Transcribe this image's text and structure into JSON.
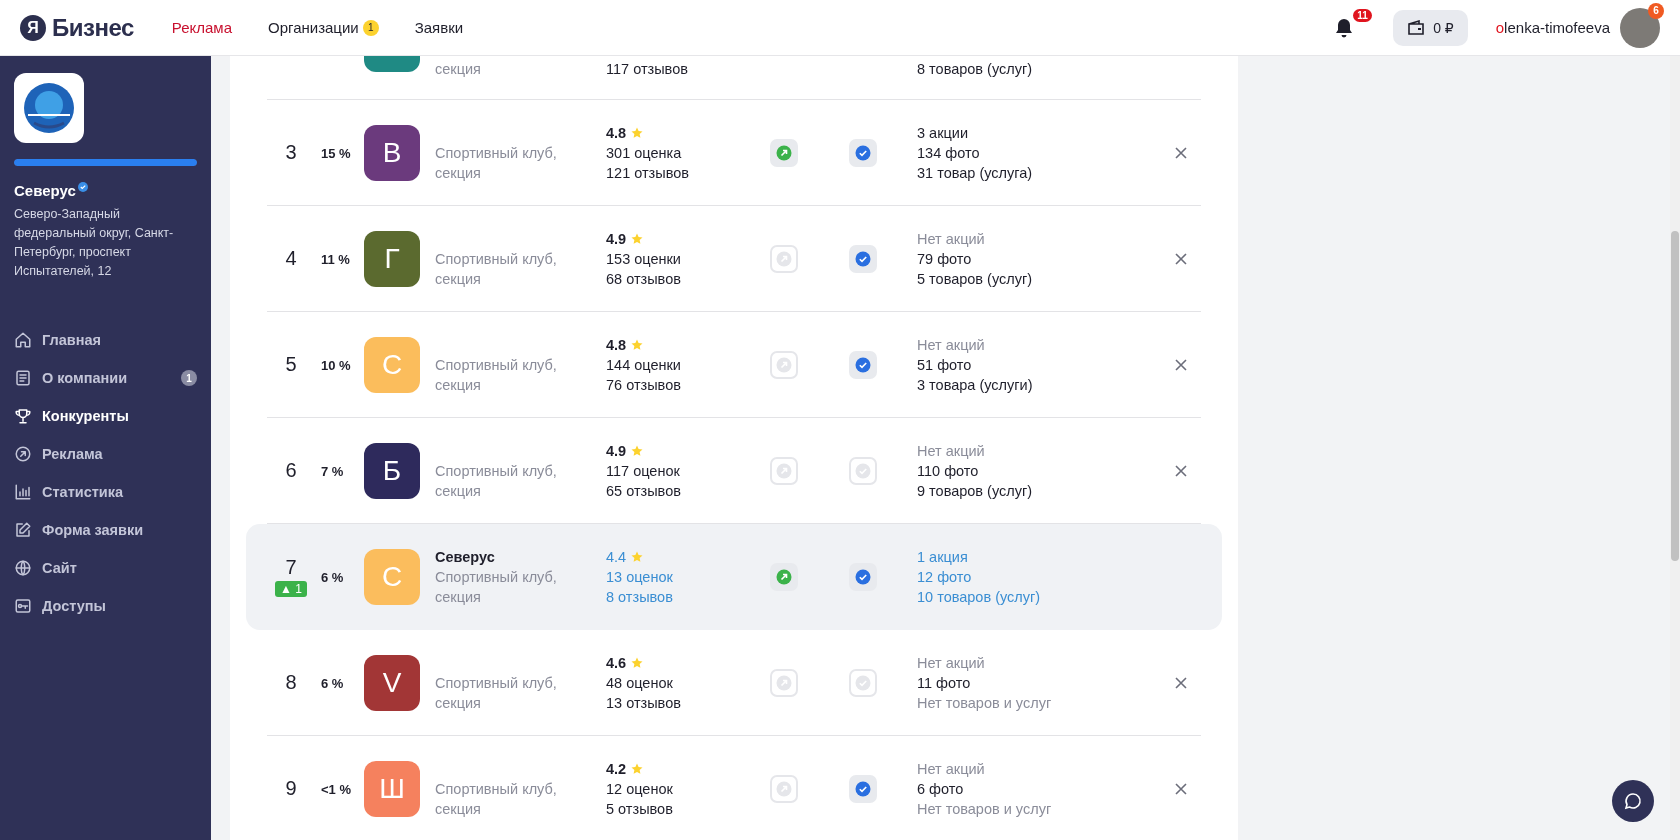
{
  "header": {
    "logo_mark": "Я",
    "logo_text": "Бизнес",
    "nav": [
      {
        "label": "Реклама",
        "selected": true
      },
      {
        "label": "Организации",
        "selected": false,
        "badge": "1"
      },
      {
        "label": "Заявки",
        "selected": false
      }
    ],
    "notifications": "11",
    "wallet": "0 ₽",
    "user": "olenka-timofeeva",
    "avatar_badge": "6"
  },
  "sidebar": {
    "company": "Северус",
    "verified": true,
    "progress": {
      "level": 1
    },
    "address": "Северо-Западный федеральный округ, Санкт-Петербург, проспект Испытателей, 12",
    "items": [
      {
        "kind": "home",
        "label": "Главная",
        "selected": false
      },
      {
        "kind": "doc",
        "label": "О компании",
        "selected": false,
        "badge": "1"
      },
      {
        "kind": "trophy",
        "label": "Конкуренты",
        "selected": true
      },
      {
        "kind": "ads",
        "label": "Реклама",
        "selected": false
      },
      {
        "kind": "stats",
        "label": "Статистика",
        "selected": false
      },
      {
        "kind": "form",
        "label": "Форма заявки",
        "selected": false
      },
      {
        "kind": "site",
        "label": "Сайт",
        "selected": false
      },
      {
        "kind": "access",
        "label": "Доступы",
        "selected": false
      }
    ]
  },
  "competitors": [
    {
      "kind": "partial",
      "color": "#1f8a84",
      "category": "секция",
      "reviews": "117 отзывов",
      "stats": [
        {
          "text": "8 товаров (услуг)",
          "muted": false
        }
      ]
    },
    {
      "kind": "full",
      "own": false,
      "rank": "3",
      "percent": "15 %",
      "letter": "В",
      "color": "#6b3a7d",
      "category": "Спортивный клуб, секция",
      "rating": "4.8",
      "ratings_count": "301 оценка",
      "reviews": "121 отзывов",
      "promoted": true,
      "verified": true,
      "stats": [
        {
          "text": "3 акции",
          "muted": false
        },
        {
          "text": "134 фото",
          "muted": false
        },
        {
          "text": "31 товар (услуга)",
          "muted": false
        }
      ]
    },
    {
      "kind": "full",
      "own": false,
      "rank": "4",
      "percent": "11 %",
      "letter": "Г",
      "color": "#5b6a2f",
      "category": "Спортивный клуб, секция",
      "rating": "4.9",
      "ratings_count": "153 оценки",
      "reviews": "68 отзывов",
      "promoted": false,
      "verified": true,
      "stats": [
        {
          "text": "Нет акций",
          "muted": true
        },
        {
          "text": "79 фото",
          "muted": false
        },
        {
          "text": "5 товаров (услуг)",
          "muted": false
        }
      ]
    },
    {
      "kind": "full",
      "own": false,
      "rank": "5",
      "percent": "10 %",
      "letter": "С",
      "color": "#fbbd5c",
      "category": "Спортивный клуб, секция",
      "rating": "4.8",
      "ratings_count": "144 оценки",
      "reviews": "76 отзывов",
      "promoted": false,
      "verified": true,
      "stats": [
        {
          "text": "Нет акций",
          "muted": true
        },
        {
          "text": "51 фото",
          "muted": false
        },
        {
          "text": "3 товара (услуги)",
          "muted": false
        }
      ]
    },
    {
      "kind": "full",
      "own": false,
      "rank": "6",
      "percent": "7 %",
      "letter": "Б",
      "color": "#2e2a5c",
      "category": "Спортивный клуб, секция",
      "rating": "4.9",
      "ratings_count": "117 оценок",
      "reviews": "65 отзывов",
      "promoted": false,
      "verified": false,
      "stats": [
        {
          "text": "Нет акций",
          "muted": true
        },
        {
          "text": "110 фото",
          "muted": false
        },
        {
          "text": "9 товаров (услуг)",
          "muted": false
        }
      ]
    },
    {
      "kind": "full",
      "own": true,
      "rank": "7",
      "change": "▲ 1",
      "percent": "6 %",
      "letter": "С",
      "color": "#fbbd5d",
      "name": "Северус",
      "category": "Спортивный клуб, секция",
      "rating": "4.4",
      "ratings_count": "13 оценок",
      "reviews": "8 отзывов",
      "promoted": true,
      "verified": true,
      "stats": [
        {
          "text": "1 акция",
          "muted": false
        },
        {
          "text": "12 фото",
          "muted": false
        },
        {
          "text": "10 товаров (услуг)",
          "muted": false
        }
      ]
    },
    {
      "kind": "full",
      "own": false,
      "rank": "8",
      "percent": "6 %",
      "letter": "V",
      "color": "#a23636",
      "category": "Спортивный клуб, секция",
      "rating": "4.6",
      "ratings_count": "48 оценок",
      "reviews": "13 отзывов",
      "promoted": false,
      "verified": false,
      "stats": [
        {
          "text": "Нет акций",
          "muted": true
        },
        {
          "text": "11 фото",
          "muted": false
        },
        {
          "text": "Нет товаров и услуг",
          "muted": true
        }
      ]
    },
    {
      "kind": "full",
      "own": false,
      "rank": "9",
      "percent": "<1 %",
      "letter": "Ш",
      "color": "#f5815e",
      "category": "Спортивный клуб, секция",
      "rating": "4.2",
      "ratings_count": "12 оценок",
      "reviews": "5 отзывов",
      "promoted": false,
      "verified": true,
      "stats": [
        {
          "text": "Нет акций",
          "muted": true
        },
        {
          "text": "6 фото",
          "muted": false
        },
        {
          "text": "Нет товаров и услуг",
          "muted": true
        }
      ]
    }
  ]
}
